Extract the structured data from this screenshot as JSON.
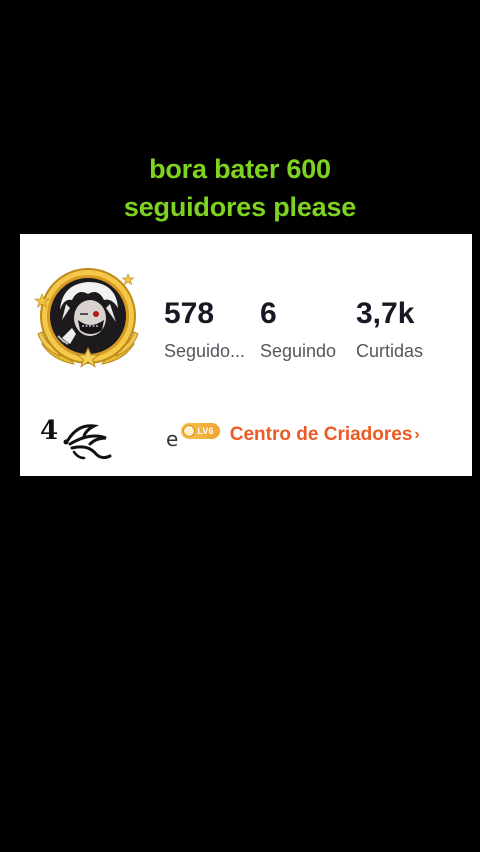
{
  "caption": {
    "line1": "bora bater 600",
    "line2": "seguidores please"
  },
  "profile": {
    "avatar_icon": "avatar-gold-frame-icon",
    "stats": [
      {
        "value": "578",
        "label": "Seguido..."
      },
      {
        "value": "6",
        "label": "Seguindo"
      },
      {
        "value": "3,7k",
        "label": "Curtidas"
      }
    ]
  },
  "bottom": {
    "brand_number": "4",
    "brand_icon": "swirl-logo-icon",
    "small_glyph": "e",
    "level_badge": "LV6",
    "creator_center": "Centro de Criadores",
    "arrow": "›"
  },
  "colors": {
    "caption_green": "#7ed321",
    "creator_orange": "#ee5a24",
    "badge_gold": "#f1a531",
    "background": "#000000",
    "card": "#ffffff"
  }
}
